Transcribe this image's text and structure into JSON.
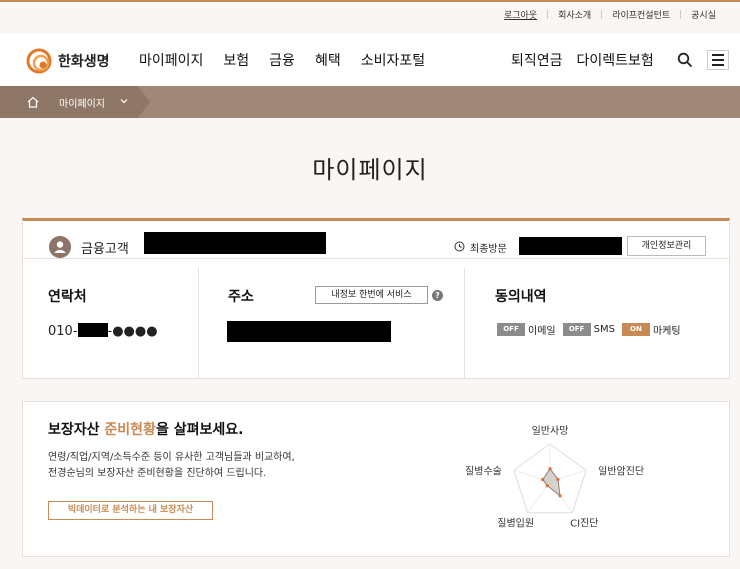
{
  "util_links": [
    "로그아웃",
    "회사소개",
    "라이프컨설턴트",
    "공시실"
  ],
  "brand": {
    "name": "한화생명",
    "accent": "#c88a55"
  },
  "nav": {
    "main": [
      "마이페이지",
      "보험",
      "금융",
      "혜택",
      "소비자포털"
    ],
    "right": [
      "퇴직연금",
      "다이렉트보험"
    ]
  },
  "breadcrumb": {
    "current": "마이페이지"
  },
  "page_title": "마이페이지",
  "customer": {
    "grade_label": "금융고객",
    "last_visit_label": "최종방문",
    "privacy_button": "개인정보관리"
  },
  "contact": {
    "title": "연락처",
    "phone_prefix": "010-",
    "phone_suffix": "-●●●●"
  },
  "address": {
    "title": "주소",
    "service_button": "내정보 한번에 서비스",
    "help": "?"
  },
  "consent": {
    "title": "동의내역",
    "items": [
      {
        "state": "OFF",
        "label": "이메일"
      },
      {
        "state": "OFF",
        "label": "SMS"
      },
      {
        "state": "ON",
        "label": "마케팅"
      }
    ]
  },
  "assets": {
    "title_pre": "보장자산 ",
    "title_highlight": "준비현황",
    "title_post": "을 살펴보세요.",
    "desc_line1": "연령/직업/지역/소득수준 등이 유사한 고객님들과 비교하여,",
    "desc_line2": "전경순님의 보장자산 준비현황을 진단하여 드립니다.",
    "button": "빅데이터로 분석하는 내 보장자산"
  },
  "radar": {
    "axes": [
      "일반사망",
      "일반암진단",
      "CI진단",
      "질병입원",
      "질병수술"
    ],
    "values": [
      0.35,
      0.22,
      0.45,
      0.12,
      0.2
    ]
  }
}
